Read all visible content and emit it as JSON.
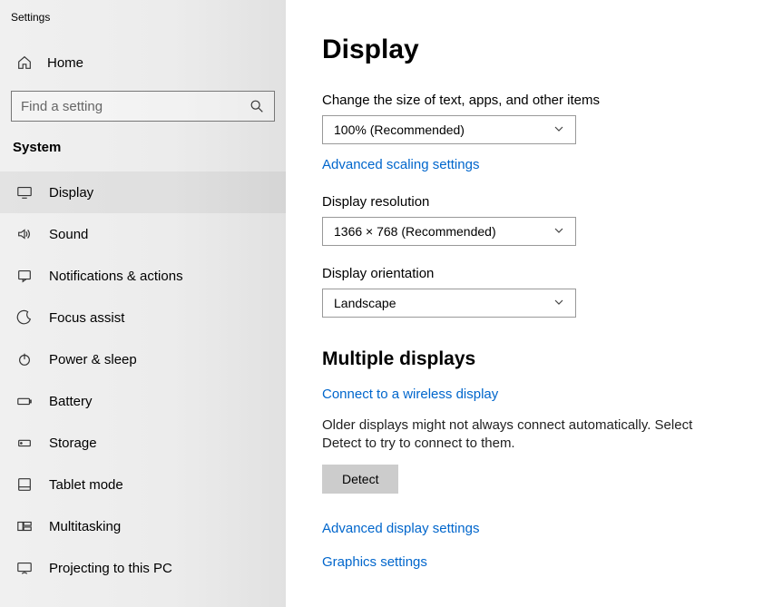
{
  "window_title": "Settings",
  "home_label": "Home",
  "search_placeholder": "Find a setting",
  "category": "System",
  "nav": [
    {
      "label": "Display"
    },
    {
      "label": "Sound"
    },
    {
      "label": "Notifications & actions"
    },
    {
      "label": "Focus assist"
    },
    {
      "label": "Power & sleep"
    },
    {
      "label": "Battery"
    },
    {
      "label": "Storage"
    },
    {
      "label": "Tablet mode"
    },
    {
      "label": "Multitasking"
    },
    {
      "label": "Projecting to this PC"
    }
  ],
  "page": {
    "title": "Display",
    "scale_label": "Change the size of text, apps, and other items",
    "scale_value": "100% (Recommended)",
    "advanced_scaling_link": "Advanced scaling settings",
    "resolution_label": "Display resolution",
    "resolution_value": "1366 × 768 (Recommended)",
    "orientation_label": "Display orientation",
    "orientation_value": "Landscape",
    "multiple_displays_heading": "Multiple displays",
    "connect_wireless_link": "Connect to a wireless display",
    "older_displays_text": "Older displays might not always connect automatically. Select Detect to try to connect to them.",
    "detect_button": "Detect",
    "advanced_display_link": "Advanced display settings",
    "graphics_link": "Graphics settings"
  }
}
